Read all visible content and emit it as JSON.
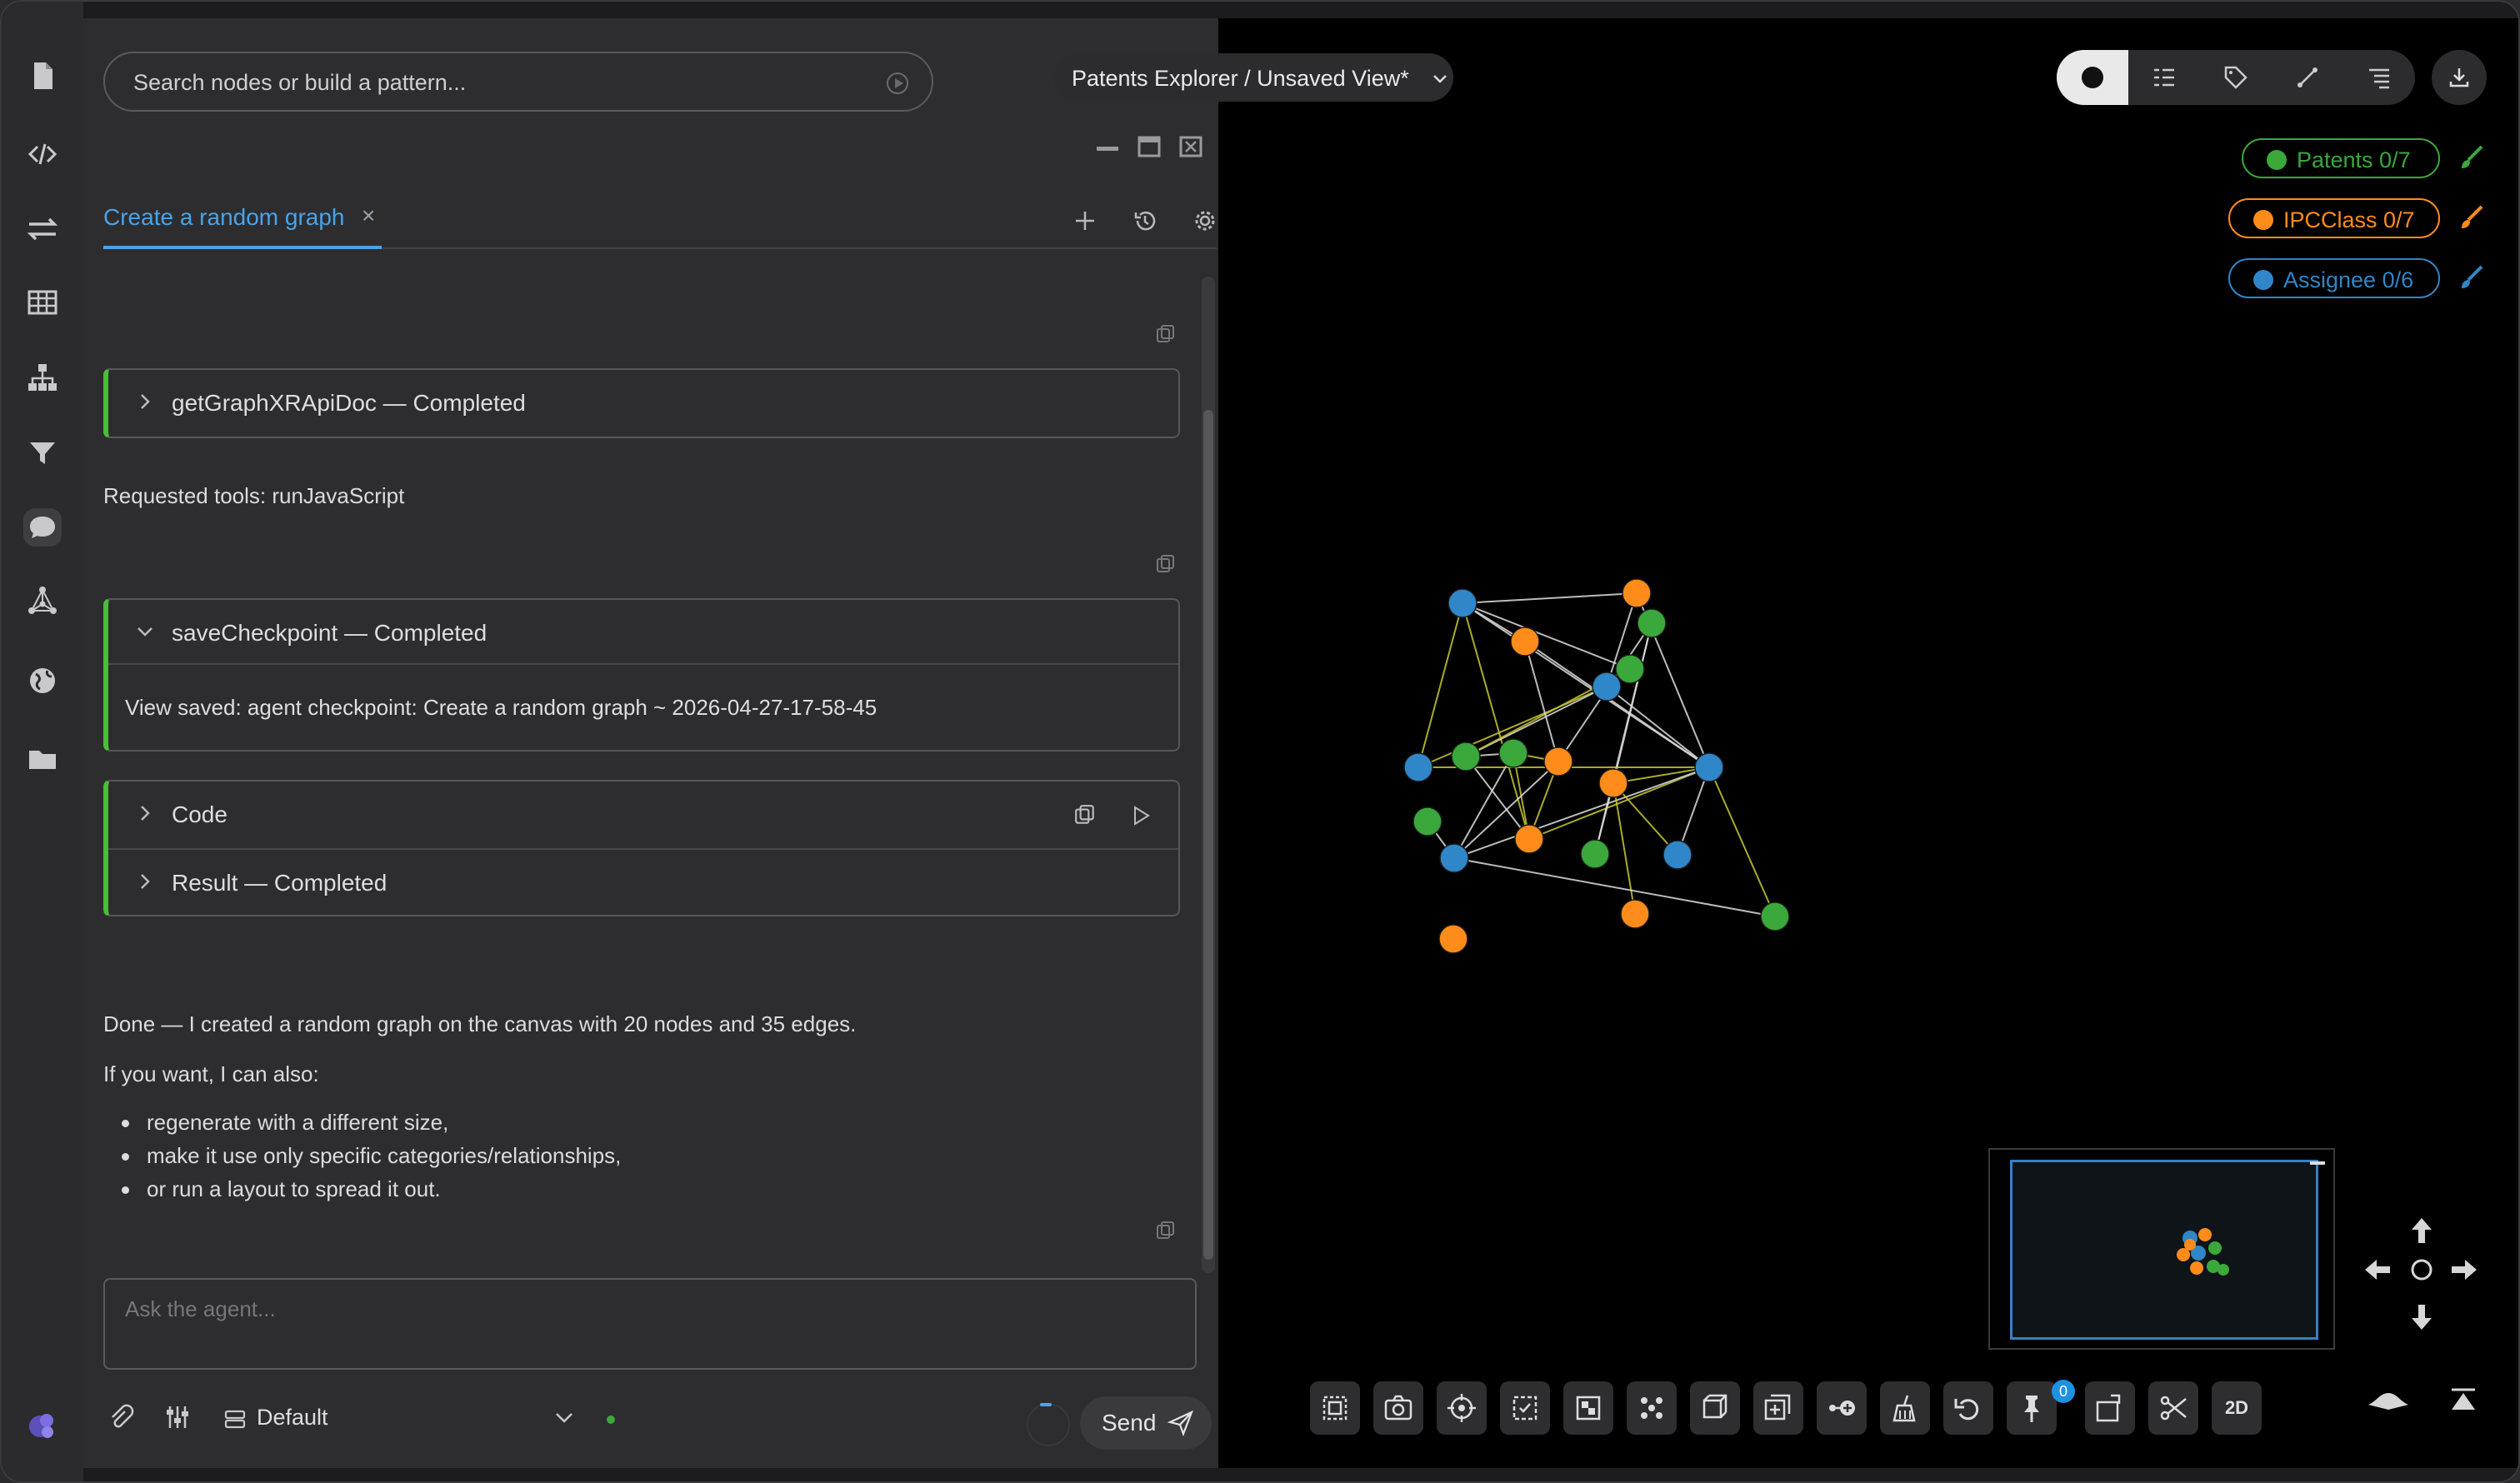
{
  "search": {
    "placeholder": "Search nodes or build a pattern..."
  },
  "view_selector": {
    "label": "Patents Explorer / Unsaved View*"
  },
  "tab": {
    "label": "Create a random graph",
    "close": "×"
  },
  "chat": {
    "tool1": {
      "title": "getGraphXRApiDoc — Completed"
    },
    "requested": "Requested tools: runJavaScript",
    "tool2": {
      "title": "saveCheckpoint — Completed",
      "body": "View saved: agent checkpoint: Create a random graph ~ 2026-04-27-17-58-45"
    },
    "code": {
      "title": "Code"
    },
    "result": {
      "title": "Result — Completed"
    },
    "done": "Done — I created a random graph on the canvas with 20 nodes and 35 edges.",
    "offer": "If you want, I can also:",
    "options": [
      "regenerate with a different size,",
      "make it use only specific categories/relationships,",
      "or run a layout to spread it out."
    ]
  },
  "composer": {
    "placeholder": "Ask the agent...",
    "preset": "Default",
    "send": "Send"
  },
  "legend": [
    {
      "label": "Patents 0/7",
      "color": "#3aa83a"
    },
    {
      "label": "IPCClass 0/7",
      "color": "#ff8c1a"
    },
    {
      "label": "Assignee 0/6",
      "color": "#2f86c8"
    }
  ],
  "pin_count": "0",
  "toolbar": {
    "mode_2d": "2D"
  },
  "graph": {
    "node_count": 20,
    "edge_count": 35,
    "colors": {
      "patent": "#3aa83a",
      "ipc": "#ff8c1a",
      "assignee": "#2f86c8"
    }
  },
  "icons": {
    "rail": [
      "file-icon",
      "code-icon",
      "transfer-icon",
      "table-icon",
      "hierarchy-icon",
      "filter-icon",
      "chat-icon",
      "network-icon",
      "globe-icon",
      "folder-icon",
      "logo-icon"
    ]
  }
}
